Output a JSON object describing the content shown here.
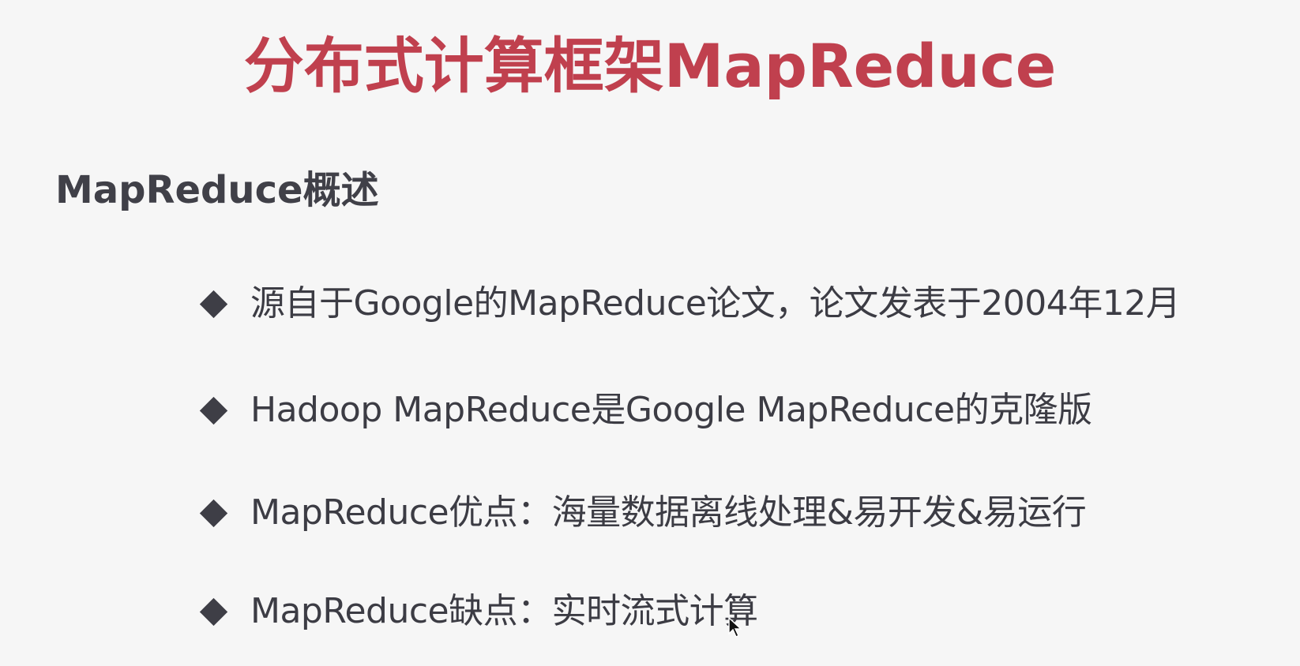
{
  "slide": {
    "title": "分布式计算框架MapReduce",
    "subtitle": "MapReduce概述",
    "bullets": [
      "源自于Google的MapReduce论文，论文发表于2004年12月",
      "Hadoop MapReduce是Google MapReduce的克隆版",
      "MapReduce优点：海量数据离线处理&易开发&易运行",
      "MapReduce缺点：实时流式计算"
    ],
    "bullet_icon": "diamond-bullet-icon",
    "cursor_icon": "mouse-pointer-icon"
  },
  "colors": {
    "title": "#c0404e",
    "text": "#3c3c44",
    "background": "#f6f6f6"
  }
}
